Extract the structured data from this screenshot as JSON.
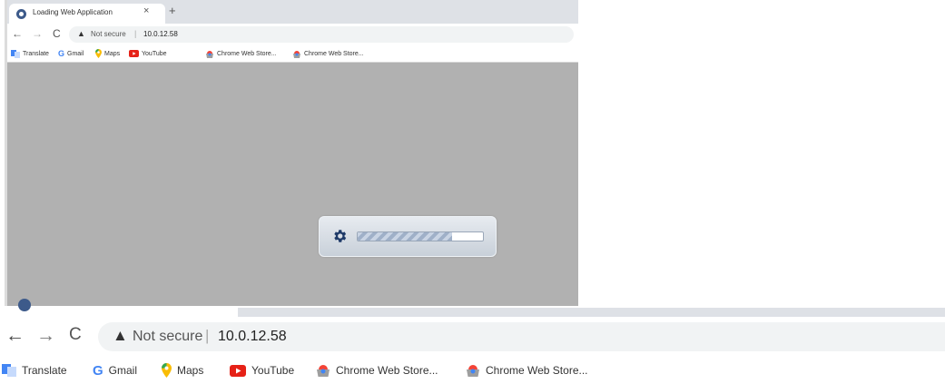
{
  "top_window": {
    "tab_title": "Loading Web Application",
    "tab_close": "×",
    "new_tab": "+",
    "nav": {
      "back": "←",
      "forward": "→",
      "reload": "C"
    },
    "security_icon": "▲",
    "security_text": "Not secure",
    "url_separator": "|",
    "url": "10.0.12.58",
    "bookmarks": [
      {
        "label": "Translate",
        "icon": "translate-icon"
      },
      {
        "label": "Gmail",
        "icon": "google-icon"
      },
      {
        "label": "Maps",
        "icon": "maps-pin-icon"
      },
      {
        "label": "YouTube",
        "icon": "youtube-icon"
      },
      {
        "label": "Chrome Web Store...",
        "icon": "chrome-web-store-icon"
      },
      {
        "label": "Chrome Web Store...",
        "icon": "chrome-web-store-icon"
      }
    ],
    "loader": {
      "icon": "gear-icon",
      "progress": 0.75
    }
  },
  "bottom_window": {
    "nav": {
      "back": "←",
      "forward": "→",
      "reload": "C"
    },
    "security_icon": "▲",
    "security_text": "Not secure",
    "url_separator": "|",
    "url": "10.0.12.58",
    "bookmarks": [
      {
        "label": "Translate",
        "icon": "translate-icon"
      },
      {
        "label": "Gmail",
        "icon": "google-icon"
      },
      {
        "label": "Maps",
        "icon": "maps-pin-icon"
      },
      {
        "label": "YouTube",
        "icon": "youtube-icon"
      },
      {
        "label": "Chrome Web Store...",
        "icon": "chrome-web-store-icon"
      },
      {
        "label": "Chrome Web Store...",
        "icon": "chrome-web-store-icon"
      }
    ]
  },
  "colors": {
    "content_bg": "#b1b1b1",
    "tabstrip": "#dee1e6",
    "omnibox": "#f1f3f4",
    "youtube_red": "#e62117",
    "maps_yellow": "#f9bc05",
    "google_blue": "#4285f4",
    "favicon_blue": "#3d5a8a",
    "gear_blue": "#1e3a68"
  }
}
